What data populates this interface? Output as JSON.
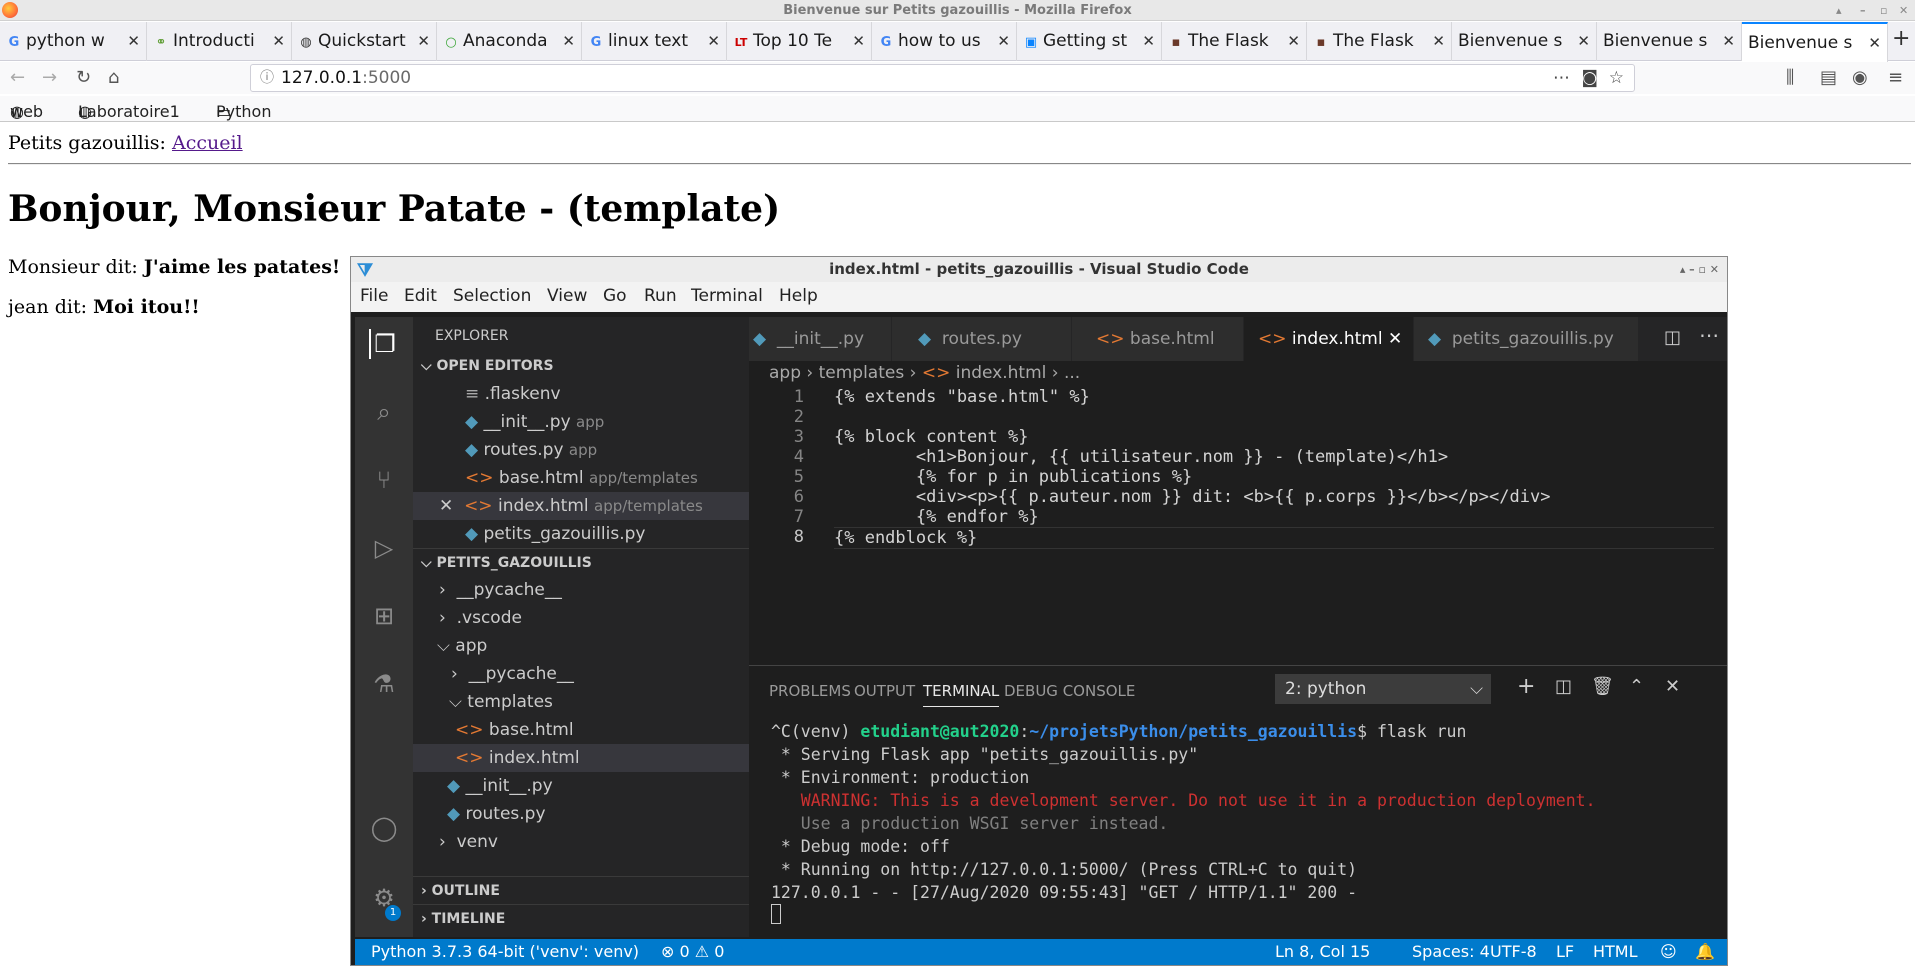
{
  "firefox": {
    "window_title": "Bienvenue sur Petits gazouillis - Mozilla Firefox",
    "tabs": [
      {
        "label": "python w",
        "icon": "G"
      },
      {
        "label": "Introducti",
        "icon": "⚭"
      },
      {
        "label": "Quickstart",
        "icon": "◍"
      },
      {
        "label": "Anaconda",
        "icon": "○"
      },
      {
        "label": "linux text",
        "icon": "G"
      },
      {
        "label": "Top 10 Te",
        "icon": "LT"
      },
      {
        "label": "how to us",
        "icon": "G"
      },
      {
        "label": "Getting st",
        "icon": "▣"
      },
      {
        "label": "The Flask",
        "icon": "▪"
      },
      {
        "label": "The Flask",
        "icon": "▪"
      },
      {
        "label": "Bienvenue s",
        "icon": ""
      },
      {
        "label": "Bienvenue s",
        "icon": ""
      },
      {
        "label": "Bienvenue s",
        "icon": ""
      }
    ],
    "url_host": "127.0.0.1",
    "url_port": ":5000",
    "bookmarks": [
      "web",
      "Laboratoire1",
      "Python"
    ]
  },
  "page": {
    "nav_prefix": "Petits gazouillis:",
    "nav_link": "Accueil",
    "heading": "Bonjour, Monsieur Patate - (template)",
    "posts": [
      {
        "author": "Monsieur dit:",
        "body": "J'aime les patates!"
      },
      {
        "author": "jean dit:",
        "body": "Moi itou!!"
      }
    ]
  },
  "vscode": {
    "title": "index.html - petits_gazouillis - Visual Studio Code",
    "menu": [
      "File",
      "Edit",
      "Selection",
      "View",
      "Go",
      "Run",
      "Terminal",
      "Help"
    ],
    "explorer_label": "EXPLORER",
    "open_editors_label": "OPEN EDITORS",
    "open_editors": [
      {
        "name": ".flaskenv",
        "path": ""
      },
      {
        "name": "__init__.py",
        "path": "app"
      },
      {
        "name": "routes.py",
        "path": "app"
      },
      {
        "name": "base.html",
        "path": "app/templates"
      },
      {
        "name": "index.html",
        "path": "app/templates"
      },
      {
        "name": "petits_gazouillis.py",
        "path": ""
      }
    ],
    "project_label": "PETITS_GAZOUILLIS",
    "tree": [
      "__pycache__",
      ".vscode",
      "app",
      "__pycache__",
      "templates",
      "base.html",
      "index.html",
      "__init__.py",
      "routes.py",
      "venv"
    ],
    "outline_label": "OUTLINE",
    "timeline_label": "TIMELINE",
    "badge": "1",
    "editor_tabs": [
      "__init__.py",
      "routes.py",
      "base.html",
      "index.html",
      "petits_gazouillis.py"
    ],
    "breadcrumb": [
      "app",
      "templates",
      "index.html",
      "..."
    ],
    "code_lines": [
      "{% extends \"base.html\" %}",
      "",
      "{% block content %}",
      "        <h1>Bonjour, {{ utilisateur.nom }} - (template)</h1>",
      "        {% for p in publications %}",
      "        <div><p>{{ p.auteur.nom }} dit: <b>{{ p.corps }}</b></p></div>",
      "        {% endfor %}",
      "{% endblock %}"
    ],
    "panel_tabs": [
      "PROBLEMS",
      "OUTPUT",
      "TERMINAL",
      "DEBUG CONSOLE"
    ],
    "terminal_select": "2: python",
    "terminal": {
      "prompt_prefix": "^C(venv) ",
      "user": "etudiant@aut2020",
      "colon": ":",
      "path": "~/projetsPython/petits_gazouillis",
      "cmd": "$ flask run",
      "lines": [
        " * Serving Flask app \"petits_gazouillis.py\"",
        " * Environment: production",
        "   WARNING: This is a development server. Do not use it in a production deployment.",
        "   Use a production WSGI server instead.",
        " * Debug mode: off",
        " * Running on http://127.0.0.1:5000/ (Press CTRL+C to quit)",
        "127.0.0.1 - - [27/Aug/2020 09:55:43] \"GET / HTTP/1.1\" 200 -"
      ]
    },
    "status": {
      "interpreter": "Python 3.7.3 64-bit ('venv': venv)",
      "errors": "⊗ 0 ⚠ 0",
      "position": "Ln 8, Col 15",
      "spaces": "Spaces: 4",
      "encoding": "UTF-8",
      "eol": "LF",
      "language": "HTML"
    }
  }
}
